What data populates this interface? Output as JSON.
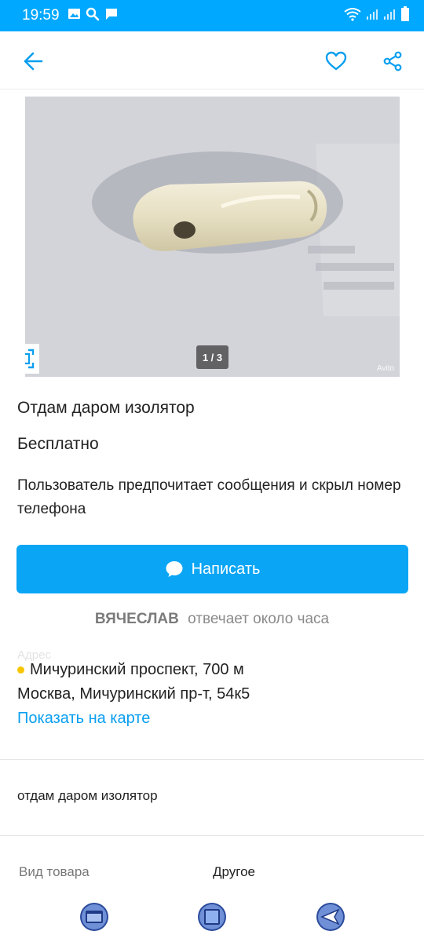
{
  "status_bar": {
    "time": "19:59",
    "icons_left": [
      "image-icon",
      "search-icon",
      "message-icon"
    ],
    "icons_right": [
      "wifi-icon",
      "signal-icon",
      "signal-icon",
      "battery-icon"
    ]
  },
  "app_bar": {
    "icons": [
      "arrow-back-icon",
      "heart-icon",
      "share-icon"
    ]
  },
  "gallery": {
    "counter": "1 / 3",
    "watermark": "Avito"
  },
  "listing": {
    "title": "Отдам даром изолятор",
    "price": "Бесплатно",
    "contact_notice": "Пользователь предпочитает сообщения и скрыл номер телефона",
    "write_button": "Написать",
    "seller_name": "ВЯЧЕСЛАВ",
    "seller_response": "отвечает около часа",
    "address_faint": "Адрес",
    "metro": "Мичуринский проспект, 700 м",
    "address": "Москва, Мичуринский пр-т, 54к5",
    "map_link": "Показать на карте",
    "description": "отдам даром изолятор",
    "params": [
      {
        "label": "Вид товара",
        "value": "Другое"
      }
    ]
  },
  "colors": {
    "accent": "#00a8ff",
    "button": "#0aa5f5",
    "link": "#0a9ff0",
    "metro_dot": "#f7c600"
  }
}
